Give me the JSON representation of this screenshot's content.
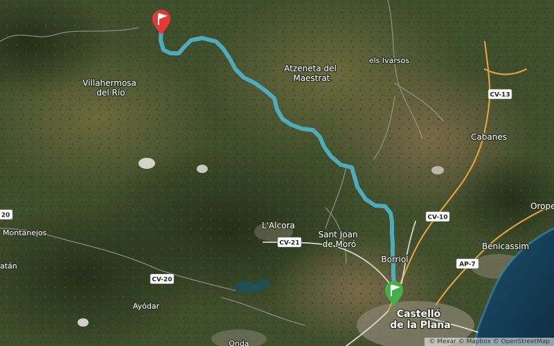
{
  "route": {
    "color": "#4fb3c8",
    "start": {
      "color": "#e53935",
      "icon": "flag-icon"
    },
    "end": {
      "color": "#43b049",
      "icon": "flag-icon"
    }
  },
  "places": [
    {
      "id": "villahermosa",
      "lines": [
        "Villahermosa",
        "del Río"
      ]
    },
    {
      "id": "atzeneta",
      "lines": [
        "Atzeneta del",
        "Maestrat"
      ]
    },
    {
      "id": "ivarsos",
      "lines": [
        "els Ivarsos"
      ]
    },
    {
      "id": "cabanes",
      "lines": [
        "Cabanes"
      ]
    },
    {
      "id": "oropesa",
      "lines": [
        "Oropes"
      ]
    },
    {
      "id": "montanejos",
      "lines": [
        "Montanejos"
      ]
    },
    {
      "id": "alcora",
      "lines": [
        "L'Alcora"
      ]
    },
    {
      "id": "santjoan",
      "lines": [
        "Sant Joan",
        "de Moró"
      ]
    },
    {
      "id": "benicassim",
      "lines": [
        "Benicassim"
      ]
    },
    {
      "id": "borriol",
      "lines": [
        "Borriol"
      ]
    },
    {
      "id": "castello",
      "lines": [
        "Castelló",
        "de la Plana"
      ]
    },
    {
      "id": "ayodar",
      "lines": [
        "Ayódar"
      ]
    },
    {
      "id": "atan",
      "lines": [
        "atán"
      ]
    },
    {
      "id": "onda",
      "lines": [
        "Onda"
      ]
    }
  ],
  "roads": [
    {
      "id": "cv13",
      "label": "CV-13"
    },
    {
      "id": "cv10",
      "label": "CV-10"
    },
    {
      "id": "cv21",
      "label": "CV-21"
    },
    {
      "id": "cv20",
      "label": "CV-20"
    },
    {
      "id": "ap7",
      "label": "AP-7"
    },
    {
      "id": "left20",
      "label": "20"
    }
  ],
  "attribution": "© Mexar © Mapbox © OpenStreetMap"
}
